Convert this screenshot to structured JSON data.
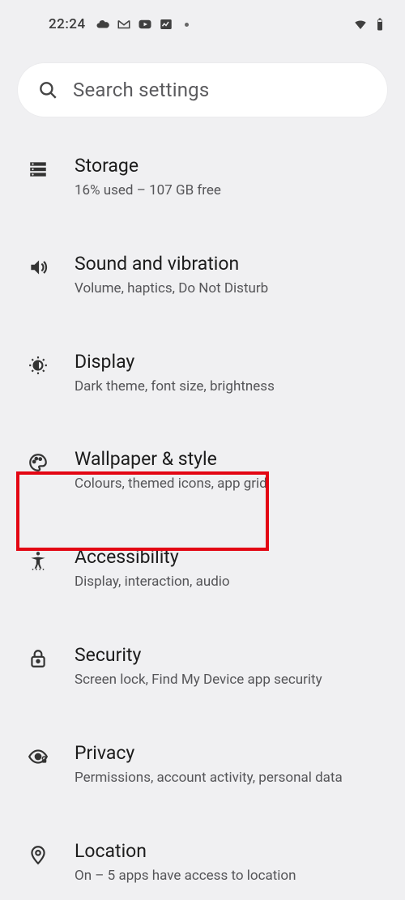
{
  "statusbar": {
    "time": "22:24"
  },
  "search": {
    "placeholder": "Search settings"
  },
  "items": [
    {
      "title": "Storage",
      "subtitle": "16% used – 107 GB free"
    },
    {
      "title": "Sound and vibration",
      "subtitle": "Volume, haptics, Do Not Disturb"
    },
    {
      "title": "Display",
      "subtitle": "Dark theme, font size, brightness"
    },
    {
      "title": "Wallpaper & style",
      "subtitle": "Colours, themed icons, app grid"
    },
    {
      "title": "Accessibility",
      "subtitle": "Display, interaction, audio"
    },
    {
      "title": "Security",
      "subtitle": "Screen lock, Find My Device app security"
    },
    {
      "title": "Privacy",
      "subtitle": "Permissions, account activity, personal data"
    },
    {
      "title": "Location",
      "subtitle": "On – 5 apps have access to location"
    }
  ]
}
